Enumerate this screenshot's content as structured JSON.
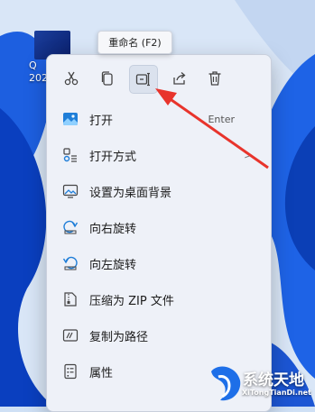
{
  "desktop": {
    "icon_label": "Q\n202"
  },
  "tooltip": {
    "text": "重命名 (F2)"
  },
  "toolbar": {
    "buttons": [
      {
        "name": "cut"
      },
      {
        "name": "copy"
      },
      {
        "name": "rename"
      },
      {
        "name": "share"
      },
      {
        "name": "delete"
      }
    ]
  },
  "menu": {
    "items": [
      {
        "label": "打开",
        "accelerator": "Enter",
        "icon": "image-icon"
      },
      {
        "label": "打开方式",
        "chevron": ">",
        "icon": "open-with-icon"
      },
      {
        "label": "设置为桌面背景",
        "icon": "wallpaper-icon"
      },
      {
        "label": "向右旋转",
        "icon": "rotate-right-icon"
      },
      {
        "label": "向左旋转",
        "icon": "rotate-left-icon"
      },
      {
        "label": "压缩为 ZIP 文件",
        "icon": "zip-icon"
      },
      {
        "label": "复制为路径",
        "icon": "copy-path-icon"
      },
      {
        "label": "属性",
        "icon": "properties-icon"
      }
    ]
  },
  "watermark": {
    "title": "系统天地",
    "url": "XiTongTianDi.net"
  },
  "colors": {
    "accent": "#0067c0",
    "arrow": "#e8342c"
  }
}
